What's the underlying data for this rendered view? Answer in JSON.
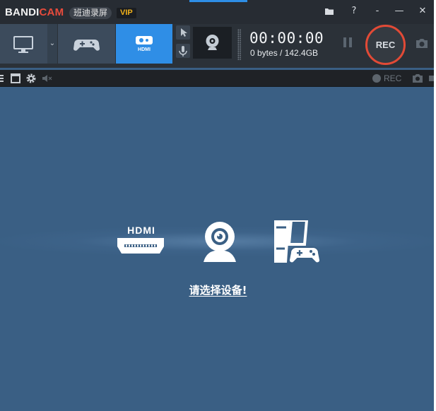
{
  "titlebar": {
    "brand_main": "BANDI",
    "brand_accent": "CAM",
    "cn_title": "班迪录屏",
    "vip": "VIP",
    "buttons": {
      "folder": "folder-icon",
      "help": "?",
      "menu": "-",
      "minimize": "—",
      "close": "✕"
    }
  },
  "modes": [
    {
      "name": "screen",
      "icon": "monitor-icon"
    },
    {
      "name": "game",
      "icon": "gamepad-icon"
    },
    {
      "name": "device",
      "icon": "hdmi-icon",
      "label": "HDMI",
      "active": true
    }
  ],
  "recorder": {
    "timer": "00:00:00",
    "size_info": "0 bytes / 142.4GB",
    "rec_label": "REC"
  },
  "substrip": {
    "rec_label": "REC"
  },
  "devices": {
    "hdmi_label": "HDMI",
    "select_prompt": "请选择设备!"
  },
  "colors": {
    "titlebar": "#272c33",
    "toolbar": "#2b3138",
    "active_mode": "#2f8ee6",
    "main_bg": "#3a5f84",
    "rec_ring": "#e24a36",
    "vip": "#f2b21a"
  }
}
